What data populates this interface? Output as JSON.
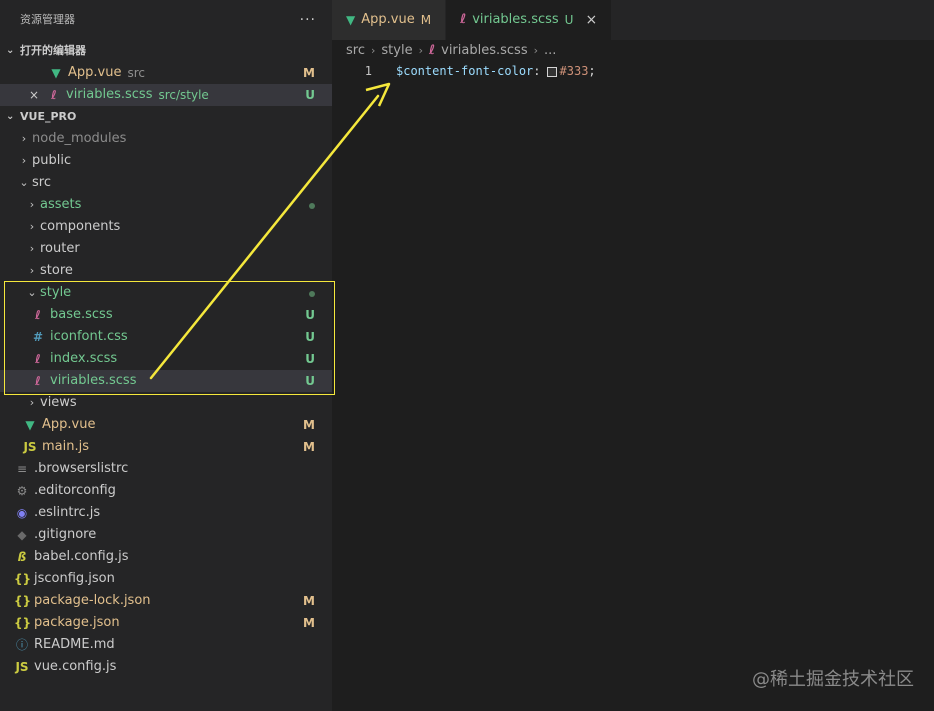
{
  "sidebar": {
    "title": "资源管理器",
    "more_glyph": "···",
    "open_editors": {
      "title": "打开的编辑器",
      "items": [
        {
          "name": "App.vue",
          "desc": "src",
          "badge": "M",
          "icon": "vue-icon"
        },
        {
          "close": "×",
          "name": "viriables.scss",
          "desc": "src/style",
          "badge": "U",
          "icon": "sass-icon"
        }
      ]
    },
    "project": {
      "title": "VUE_PRO",
      "tree": [
        {
          "name": "node_modules",
          "twistie": "›",
          "depth": 0
        },
        {
          "name": "public",
          "twistie": "›",
          "depth": 0
        },
        {
          "name": "src",
          "twistie": "⌄",
          "depth": 0
        },
        {
          "name": "assets",
          "twistie": "›",
          "depth": 1
        },
        {
          "name": "components",
          "twistie": "›",
          "depth": 1
        },
        {
          "name": "router",
          "twistie": "›",
          "depth": 1
        },
        {
          "name": "store",
          "twistie": "›",
          "depth": 1
        },
        {
          "name": "style",
          "twistie": "⌄",
          "depth": 1
        },
        {
          "name": "base.scss",
          "badge": "U",
          "icon": "sass-icon",
          "depth": 2
        },
        {
          "name": "iconfont.css",
          "badge": "U",
          "icon": "css-icon",
          "icon_glyph": "#",
          "depth": 2
        },
        {
          "name": "index.scss",
          "badge": "U",
          "icon": "sass-icon",
          "depth": 2
        },
        {
          "name": "viriables.scss",
          "badge": "U",
          "icon": "sass-icon",
          "depth": 2
        },
        {
          "name": "views",
          "twistie": "›",
          "depth": 1
        },
        {
          "name": "App.vue",
          "badge": "M",
          "icon": "vue-icon",
          "depth": 1
        },
        {
          "name": "main.js",
          "badge": "M",
          "icon": "js-icon",
          "icon_glyph": "JS",
          "depth": 1
        },
        {
          "name": ".browserslistrc",
          "icon": "lines-icon",
          "depth": 0
        },
        {
          "name": ".editorconfig",
          "icon": "gear-icon",
          "depth": 0
        },
        {
          "name": ".eslintrc.js",
          "icon": "eslint-icon",
          "depth": 0
        },
        {
          "name": ".gitignore",
          "icon": "git-icon",
          "depth": 0
        },
        {
          "name": "babel.config.js",
          "icon": "babel-icon",
          "depth": 0
        },
        {
          "name": "jsconfig.json",
          "icon": "json-icon",
          "icon_glyph": "{}",
          "depth": 0
        },
        {
          "name": "package-lock.json",
          "badge": "M",
          "icon": "json-icon",
          "icon_glyph": "{}",
          "depth": 0
        },
        {
          "name": "package.json",
          "badge": "M",
          "icon": "json-icon",
          "icon_glyph": "{}",
          "depth": 0
        },
        {
          "name": "README.md",
          "icon": "info-icon",
          "icon_glyph": "ⓘ",
          "depth": 0
        },
        {
          "name": "vue.config.js",
          "icon": "js-icon",
          "icon_glyph": "JS",
          "depth": 0
        }
      ]
    }
  },
  "tabs": [
    {
      "label": "App.vue",
      "badge": "M",
      "icon": "vue-icon"
    },
    {
      "label": "viriables.scss",
      "badge": "U",
      "icon": "sass-icon",
      "close": "×"
    }
  ],
  "breadcrumb": [
    "src",
    "style",
    "viriables.scss",
    "..."
  ],
  "editor": {
    "line_number": "1",
    "variable": "$content-font-color",
    "colon": ":",
    "value": "#333",
    "semicolon": ";",
    "swatch_color": "#333333"
  },
  "watermark": "@稀土掘金技术社区",
  "colors": {
    "annotation": "#f5e83c",
    "untracked": "#73c991",
    "modified": "#e2c08d"
  }
}
